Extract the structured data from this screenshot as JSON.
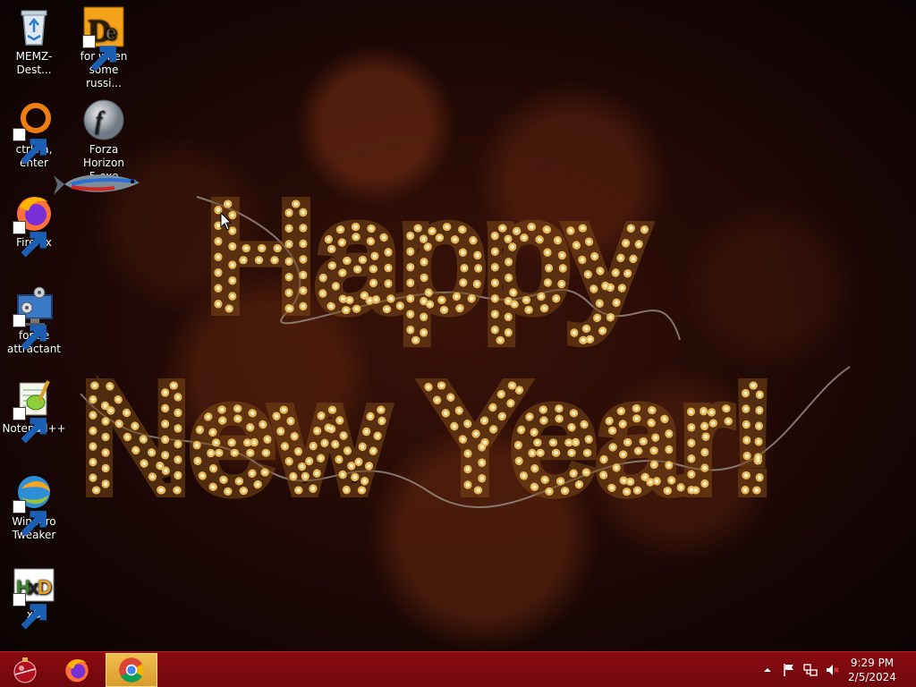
{
  "desktop": {
    "icons": [
      {
        "label": "MEMZ-Dest..."
      },
      {
        "label": "for when\nsome russi..."
      },
      {
        "label": "ctrl+a, enter"
      },
      {
        "label": "Forza Horizon\n5.exe"
      },
      {
        "label": "Firefox"
      },
      {
        "label": "forkie\nattractant"
      },
      {
        "label": "Notepad++"
      },
      {
        "label": "Winaero\nTweaker"
      },
      {
        "label": "xD"
      }
    ],
    "wallpaper": {
      "line1": "Happy",
      "line2": "New Year!"
    }
  },
  "taskbar": {
    "start_icon": "ornament-start-icon",
    "pinned": [
      {
        "name": "firefox-icon"
      },
      {
        "name": "chrome-icon",
        "active": true
      }
    ],
    "tray": {
      "show_hidden_icon": "chevron-up-icon",
      "action_center_icon": "flag-icon",
      "network_icon": "network-icon",
      "volume_icon": "volume-muted-icon"
    },
    "clock": {
      "time": "9:29 PM",
      "date": "2/5/2024"
    }
  },
  "colors": {
    "taskbar": "#7d0a10",
    "active_task": "#e8b040",
    "light_bulbs": "#f3d88a"
  }
}
